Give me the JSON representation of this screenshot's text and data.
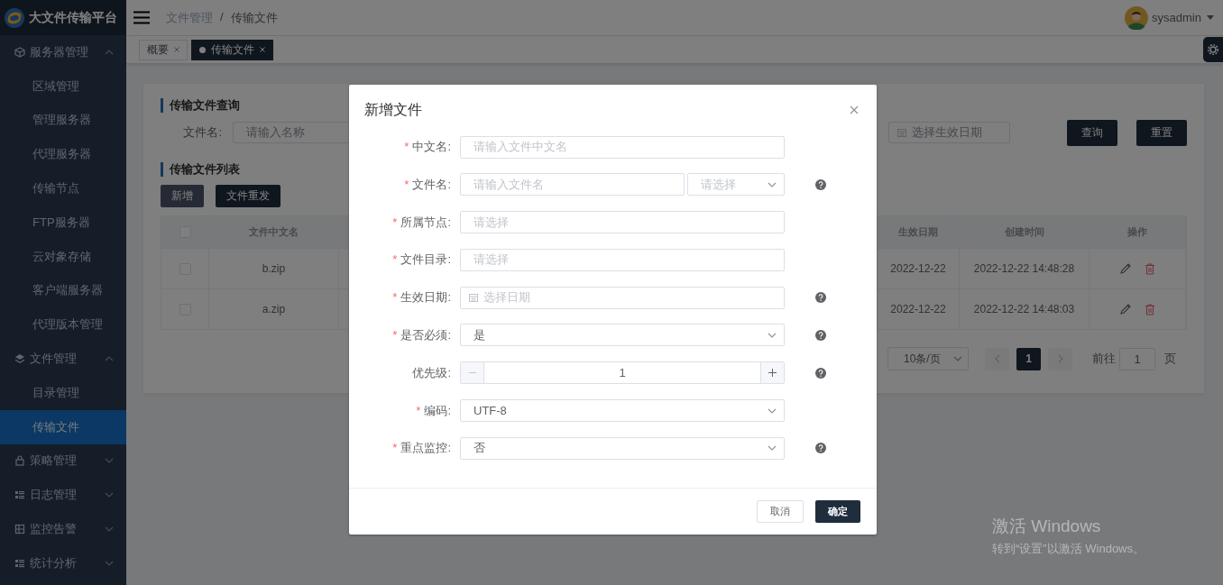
{
  "brand": {
    "title": "大文件传输平台"
  },
  "breadcrumb": [
    "文件管理",
    "传输文件"
  ],
  "breadcrumb_separator": "/",
  "user": {
    "name": "sysadmin"
  },
  "tabs": [
    {
      "label": "概要",
      "selected": false
    },
    {
      "label": "传输文件",
      "selected": true
    }
  ],
  "sidebar": {
    "items": [
      {
        "label": "服务器管理",
        "expanded": true,
        "children": [
          {
            "label": "区域管理",
            "selected": false
          },
          {
            "label": "管理服务器",
            "selected": false
          },
          {
            "label": "代理服务器",
            "selected": false
          },
          {
            "label": "传输节点",
            "selected": false
          },
          {
            "label": "FTP服务器",
            "selected": false
          },
          {
            "label": "云对象存储",
            "selected": false
          },
          {
            "label": "客户端服务器",
            "selected": false
          },
          {
            "label": "代理版本管理",
            "selected": false
          }
        ]
      },
      {
        "label": "文件管理",
        "expanded": true,
        "children": [
          {
            "label": "目录管理",
            "selected": false
          },
          {
            "label": "传输文件",
            "selected": true
          }
        ]
      },
      {
        "label": "策略管理",
        "expanded": false
      },
      {
        "label": "日志管理",
        "expanded": false
      },
      {
        "label": "监控告警",
        "expanded": false
      },
      {
        "label": "统计分析",
        "expanded": false
      }
    ]
  },
  "query": {
    "title": "传输文件查询",
    "name_label": "文件名:",
    "name_placeholder": "请输入名称",
    "date_placeholder": "选择生效日期",
    "buttons": [
      "查询",
      "重置"
    ]
  },
  "list": {
    "title": "传输文件列表",
    "buttons": [
      "新增",
      "文件重发"
    ],
    "table": {
      "header_checked": false,
      "columns": [
        "文件中文名",
        "",
        "生效日期",
        "创建时间",
        "操作"
      ],
      "rows": [
        {
          "checked": false,
          "cells": [
            "b.zip",
            "",
            "2022-12-22",
            "2022-12-22 14:48:28"
          ]
        },
        {
          "checked": false,
          "cells": [
            "a.zip",
            "",
            "2022-12-22",
            "2022-12-22 14:48:03"
          ]
        }
      ]
    }
  },
  "pagination": {
    "page_size": "10条/页",
    "pages": [
      {
        "label": "1",
        "selected": true
      }
    ],
    "goto_label": "前往",
    "goto_value": "1",
    "goto_suffix": "页"
  },
  "dialog": {
    "title": "新增文件",
    "required_mark": "*",
    "fields": [
      {
        "kind": "input",
        "label": "中文名:",
        "required": true,
        "placeholder": "请输入文件中文名",
        "help": false
      },
      {
        "kind": "input_select",
        "label": "文件名:",
        "required": true,
        "placeholder": "请输入文件名",
        "select_placeholder": "请选择",
        "help": true
      },
      {
        "kind": "input",
        "label": "所属节点:",
        "required": true,
        "placeholder": "请选择",
        "help": false
      },
      {
        "kind": "input",
        "label": "文件目录:",
        "required": true,
        "placeholder": "请选择",
        "help": false
      },
      {
        "kind": "date",
        "label": "生效日期:",
        "required": true,
        "placeholder": "选择日期",
        "help": true
      },
      {
        "kind": "select",
        "label": "是否必须:",
        "required": true,
        "value": "是",
        "help": true
      },
      {
        "kind": "number",
        "label": "优先级:",
        "required": false,
        "value": "1",
        "help": true
      },
      {
        "kind": "select",
        "label": "编码:",
        "required": true,
        "value": "UTF-8",
        "help": false
      },
      {
        "kind": "select",
        "label": "重点监控:",
        "required": true,
        "value": "否",
        "help": true
      }
    ],
    "buttons": {
      "cancel": "取消",
      "confirm": "确定"
    }
  },
  "os_notice": {
    "title": "激活 Windows",
    "subtitle": "转到“设置”以激活 Windows。"
  }
}
